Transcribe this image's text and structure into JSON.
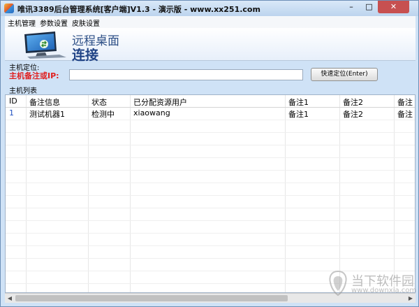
{
  "window": {
    "title": "唯讯3389后台管理系统[客户端]V1.3 - 演示版 - www.xx251.com",
    "controls": {
      "minimize": "–",
      "maximize": "□",
      "close": "✕"
    }
  },
  "menu": {
    "items": [
      {
        "label": "主机管理"
      },
      {
        "label": "参数设置"
      },
      {
        "label": "皮肤设置"
      }
    ]
  },
  "banner": {
    "line1": "远程桌面",
    "line2": "连接",
    "icon": "remote-desktop-icon"
  },
  "locate": {
    "section_label": "主机定位:",
    "field_label": "主机备注或IP:",
    "input_value": "",
    "button_label": "快速定位(Enter)"
  },
  "host_list": {
    "section_label": "主机列表",
    "columns": [
      "ID",
      "备注信息",
      "状态",
      "已分配资源用户",
      "备注1",
      "备注2",
      "备注"
    ],
    "rows": [
      {
        "id": "1",
        "note": "测试机器1",
        "status": "检测中",
        "user": "xiaowang",
        "remark1": "备注1",
        "remark2": "备注2",
        "remark3": "备注"
      }
    ]
  },
  "scrollbar": {
    "left_arrow": "◀",
    "right_arrow": "▶"
  },
  "watermark": {
    "brand": "当下软件园",
    "url": "www.downxia.com"
  },
  "colors": {
    "accent": "#1f4285",
    "label_red": "#e02020",
    "close_red": "#c75050"
  }
}
